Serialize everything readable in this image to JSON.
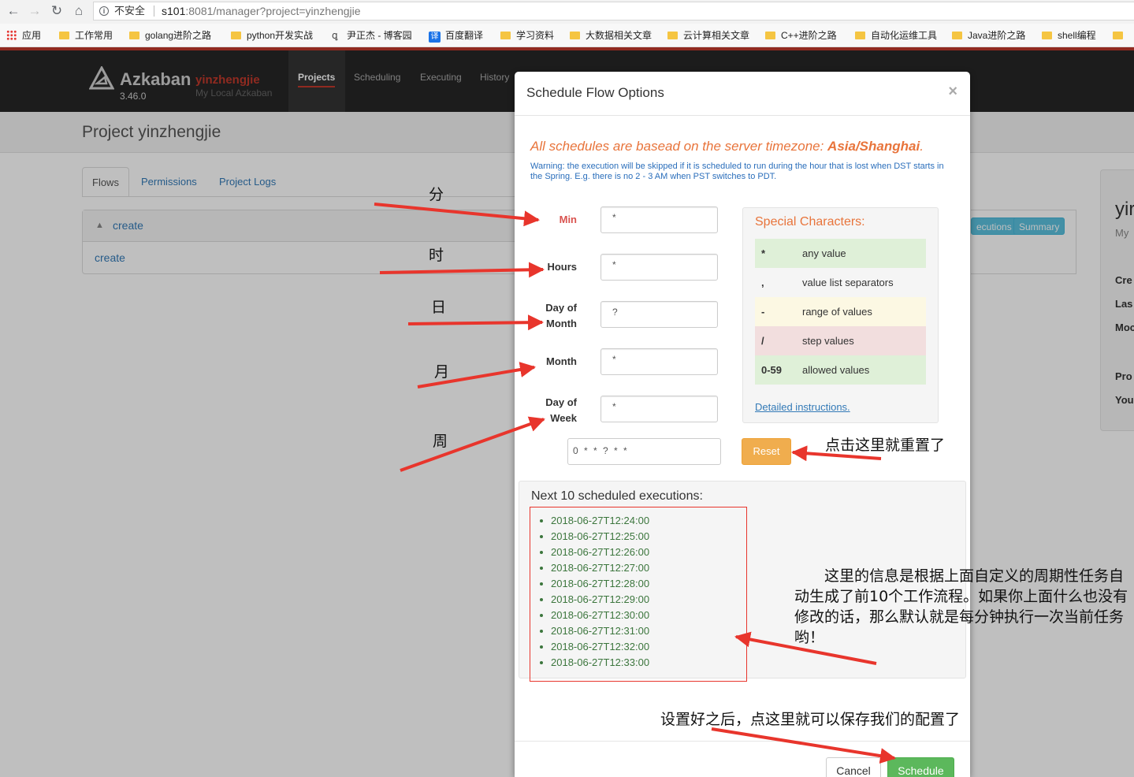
{
  "browser": {
    "security_label": "不安全",
    "url_host": "s101",
    "url_rest": ":8081/manager?project=yinzhengjie",
    "bookmarks": [
      "应用",
      "工作常用",
      "golang进阶之路",
      "python开发实战",
      "尹正杰 - 博客园",
      "百度翻译",
      "学习资料",
      "大数据相关文章",
      "云计算相关文章",
      "C++进阶之路",
      "自动化运维工具",
      "Java进阶之路",
      "shell编程"
    ],
    "translate_icon_text": "译"
  },
  "navbar": {
    "brand": "Azkaban",
    "project_name": "yinzhengjie",
    "version": "3.46.0",
    "description": "My Local Azkaban",
    "items": [
      "Projects",
      "Scheduling",
      "Executing",
      "History"
    ]
  },
  "page": {
    "title": "Project yinzhengjie",
    "tabs": [
      "Flows",
      "Permissions",
      "Project Logs"
    ],
    "flow_header": "create",
    "flow_item": "create",
    "buttons": [
      "ecutions",
      "Summary"
    ],
    "side_card": {
      "title": "yir",
      "sub": "My",
      "labels": [
        "Cre",
        "Las",
        "Moc",
        "Pro",
        "You"
      ]
    }
  },
  "modal": {
    "title": "Schedule Flow Options",
    "close": "×",
    "timezone_prefix": "All schedules are basead on the server timezone: ",
    "timezone": "Asia/Shanghai",
    "timezone_suffix": ".",
    "dst_warning": "Warning: the execution will be skipped if it is scheduled to run during the hour that is lost when DST starts in the Spring. E.g. there is no 2 - 3 AM when PST switches to PDT.",
    "fields": {
      "min_label": "Min",
      "hours_label": "Hours",
      "dom_label_1": "Day of",
      "dom_label_2": "Month",
      "month_label": "Month",
      "dow_label_1": "Day of",
      "dow_label_2": "Week",
      "min_value": "*",
      "hours_value": "*",
      "dom_value": "?",
      "month_value": "*",
      "dow_value": "*"
    },
    "cron_expression": "0 * * ? * *",
    "reset_label": "Reset",
    "special": {
      "title": "Special Characters:",
      "rows": [
        {
          "key": "*",
          "desc": "any value"
        },
        {
          "key": ",",
          "desc": "value list separators"
        },
        {
          "key": "-",
          "desc": "range of values"
        },
        {
          "key": "/",
          "desc": "step values"
        },
        {
          "key": "0-59",
          "desc": "allowed values"
        }
      ],
      "link": "Detailed instructions."
    },
    "next_title": "Next 10 scheduled executions:",
    "next_executions": [
      "2018-06-27T12:24:00",
      "2018-06-27T12:25:00",
      "2018-06-27T12:26:00",
      "2018-06-27T12:27:00",
      "2018-06-27T12:28:00",
      "2018-06-27T12:29:00",
      "2018-06-27T12:30:00",
      "2018-06-27T12:31:00",
      "2018-06-27T12:32:00",
      "2018-06-27T12:33:00"
    ],
    "cancel_label": "Cancel",
    "schedule_label": "Schedule"
  },
  "annotations": {
    "min": "分",
    "hour": "时",
    "day": "日",
    "month": "月",
    "week": "周",
    "reset_note": "点击这里就重置了",
    "executions_note": "这里的信息是根据上面自定义的周期性任务自动生成了前10个工作流程。如果你上面什么也没有修改的话，那么默认就是每分钟执行一次当前任务哟！",
    "schedule_note": "设置好之后，点这里就可以保存我们的配置了"
  },
  "colors": {
    "brand_red": "#c0392b",
    "timezone_orange": "#e8743b",
    "execution_green": "#3c763d",
    "reset_orange": "#f0ad4e",
    "schedule_green": "#5cb85c",
    "annotation_red": "#e8352c"
  }
}
